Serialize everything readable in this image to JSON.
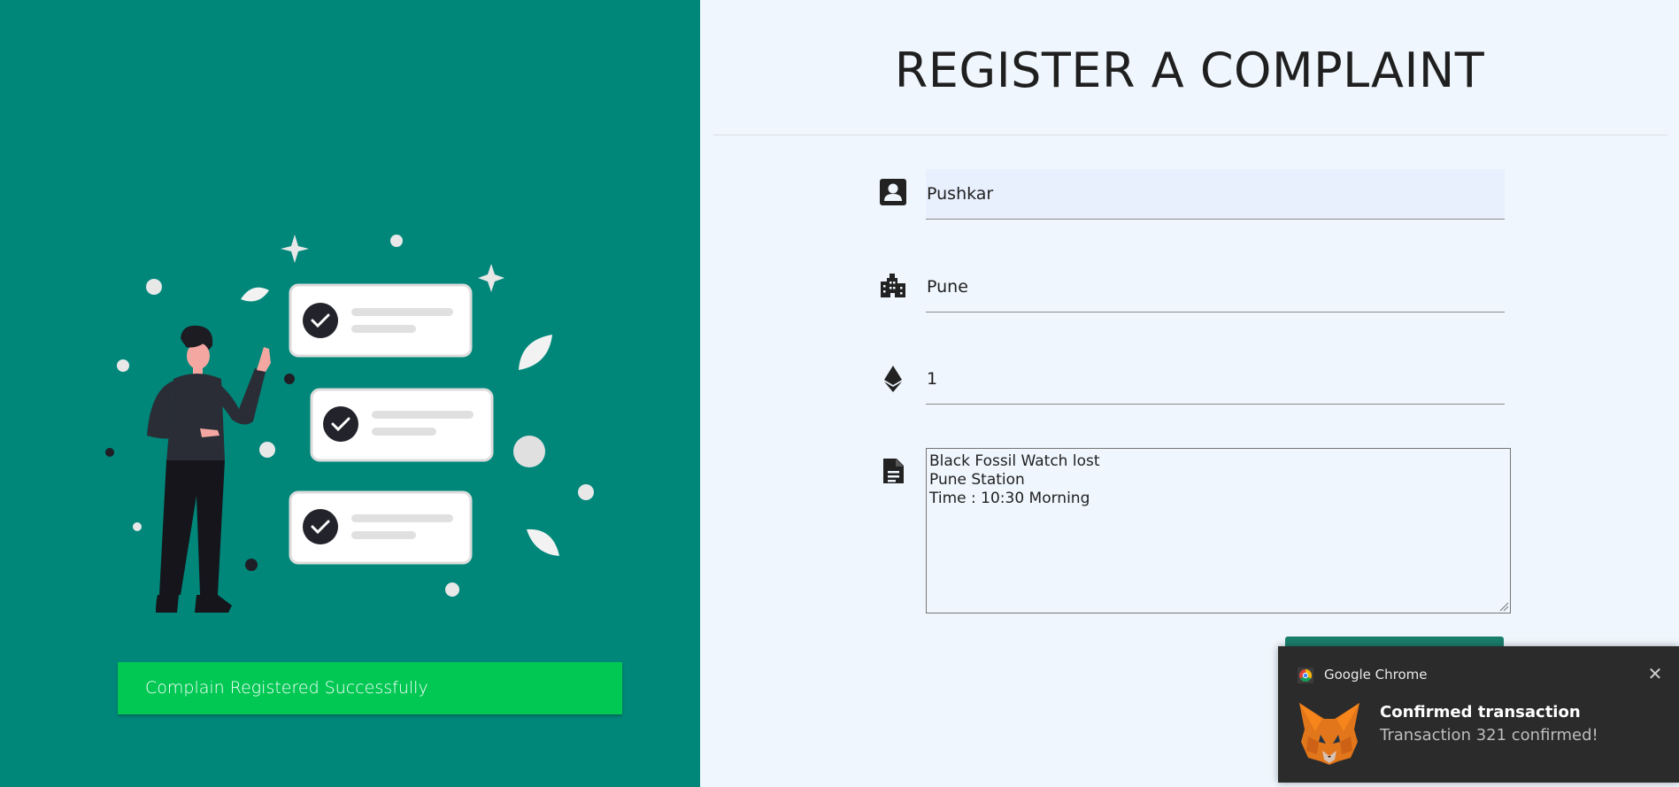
{
  "illustration": {
    "icon": "person-with-checklist-illustration"
  },
  "status": {
    "message": "Complain Registered Successfully",
    "color": "#00c853"
  },
  "form": {
    "title": "REGISTER A COMPLAINT",
    "name_value": "Pushkar",
    "city_value": "Pune",
    "amount_value": "1",
    "description_value": "Black Fossil Watch lost\nPune Station\nTime : 10:30 Morning",
    "icons": {
      "name": "person-badge-icon",
      "city": "city-buildings-icon",
      "amount": "ethereum-icon",
      "description": "document-icon"
    },
    "accent": "#1a7f6d"
  },
  "notification": {
    "app": "Google Chrome",
    "title": "Confirmed transaction",
    "message": "Transaction 321 confirmed!",
    "icon": "metamask-fox-icon"
  },
  "colors": {
    "left_panel": "#00877a",
    "right_panel": "#eff6fd"
  }
}
